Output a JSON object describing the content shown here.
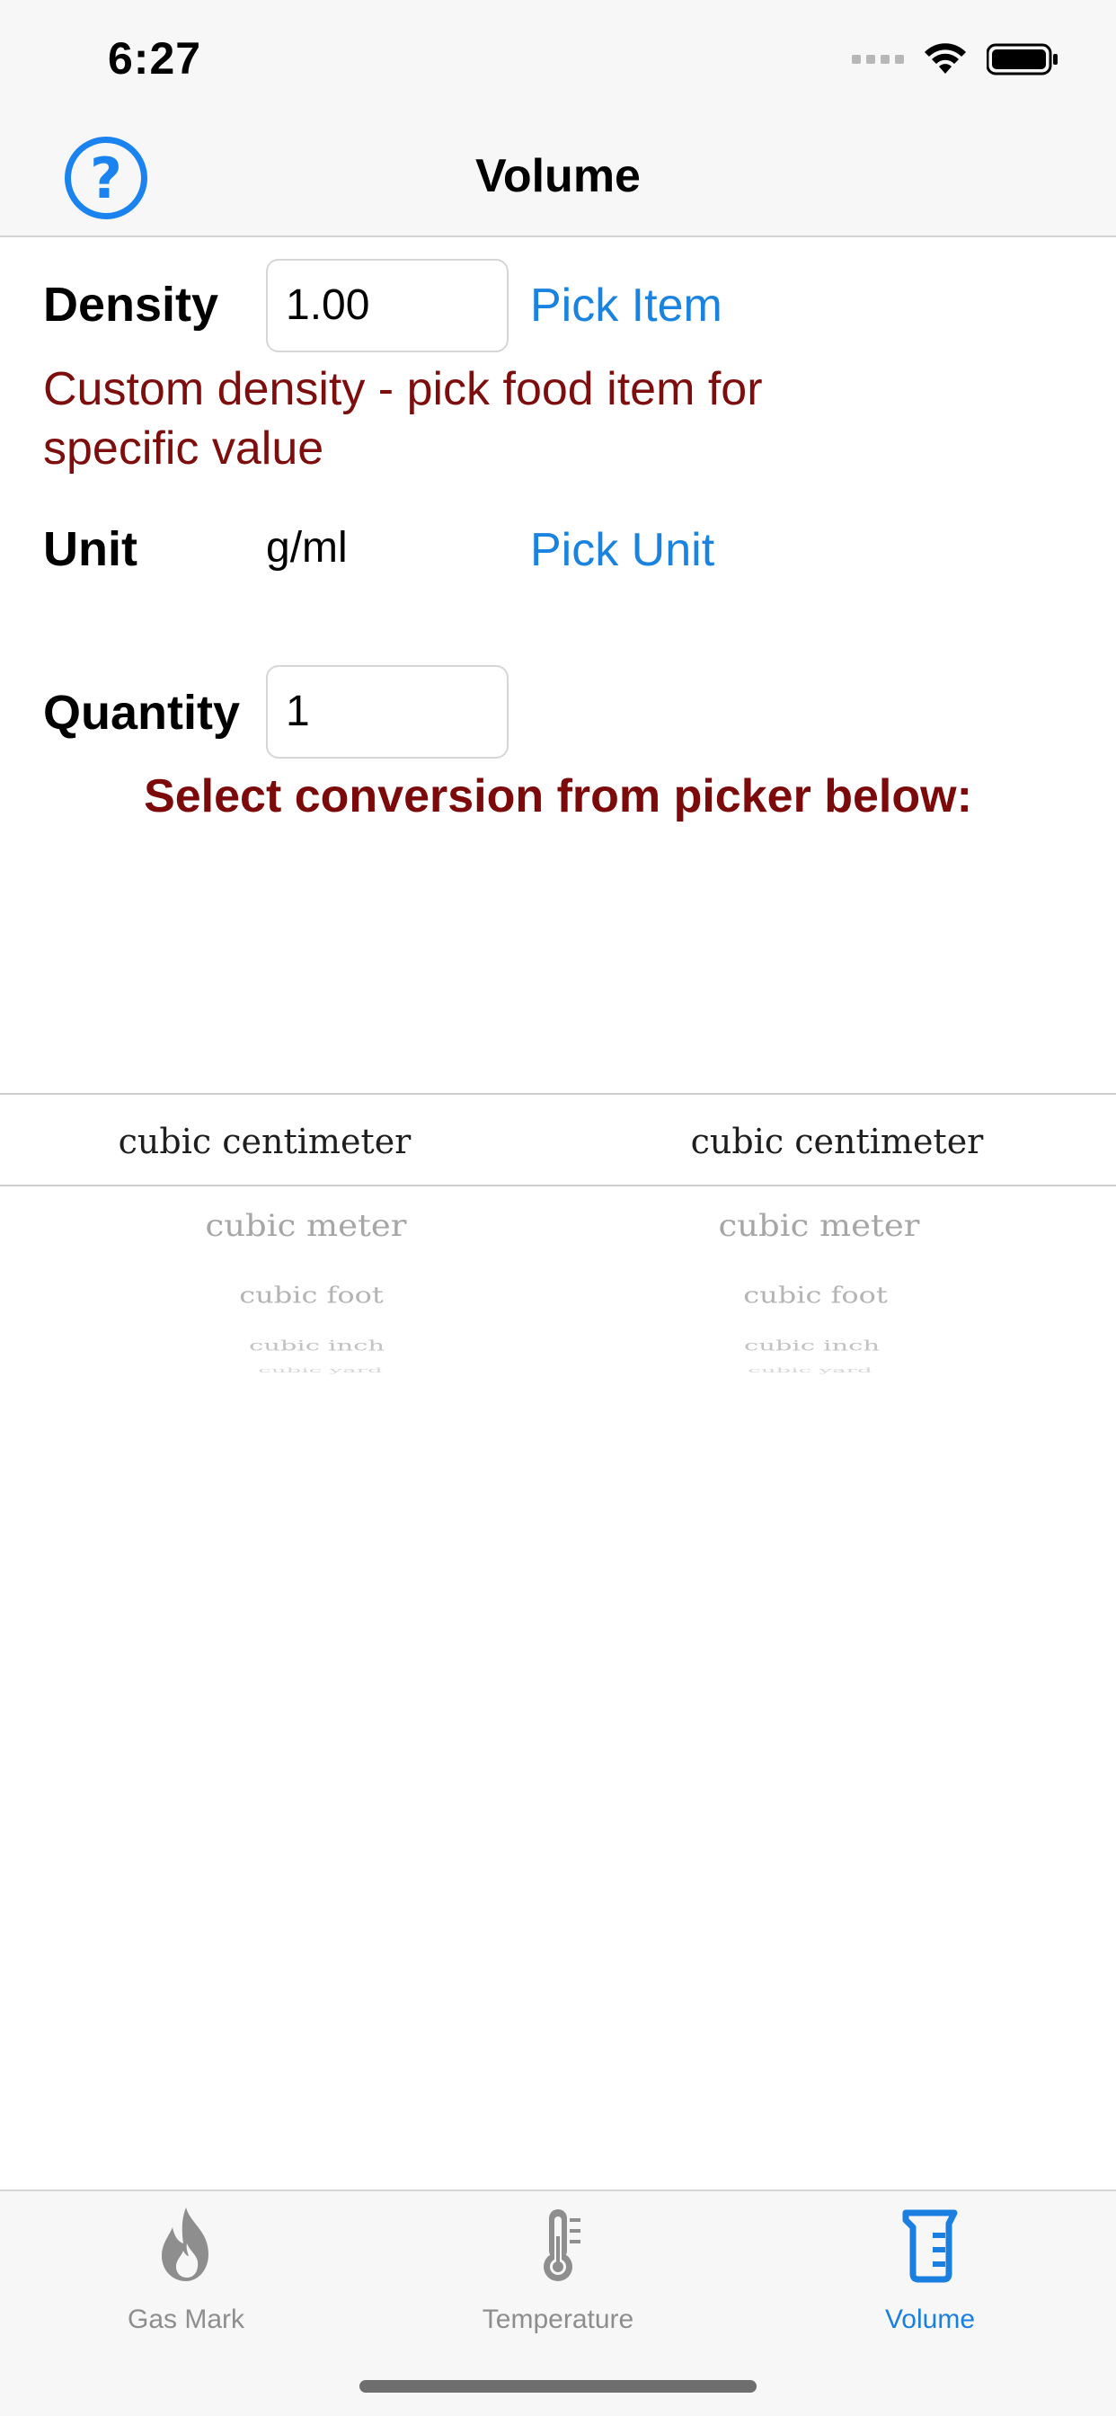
{
  "status_bar": {
    "time": "6:27"
  },
  "nav": {
    "title": "Volume",
    "help_icon": "question-circle-icon"
  },
  "form": {
    "density_label": "Density",
    "density_value": "1.00",
    "pick_item_label": "Pick Item",
    "density_note": "Custom density - pick food item for specific value",
    "unit_label": "Unit",
    "unit_value": "g/ml",
    "pick_unit_label": "Pick Unit",
    "quantity_label": "Quantity",
    "quantity_value": "1",
    "instruction": "Select conversion from picker below:"
  },
  "picker": {
    "from": {
      "selected": "cubic centimeter",
      "below": [
        "cubic meter",
        "cubic foot",
        "cubic inch",
        "cubic yard"
      ]
    },
    "to": {
      "selected": "cubic centimeter",
      "below": [
        "cubic meter",
        "cubic foot",
        "cubic inch",
        "cubic yard"
      ]
    }
  },
  "tab_bar": {
    "tabs": [
      {
        "label": "Gas Mark",
        "icon": "flame-icon",
        "active": false
      },
      {
        "label": "Temperature",
        "icon": "thermometer-icon",
        "active": false
      },
      {
        "label": "Volume",
        "icon": "measuring-cup-icon",
        "active": true
      }
    ]
  },
  "colors": {
    "accent": "#1a83e0",
    "note_red": "#7e0d0d",
    "inactive_tab": "#8e8e8e"
  }
}
